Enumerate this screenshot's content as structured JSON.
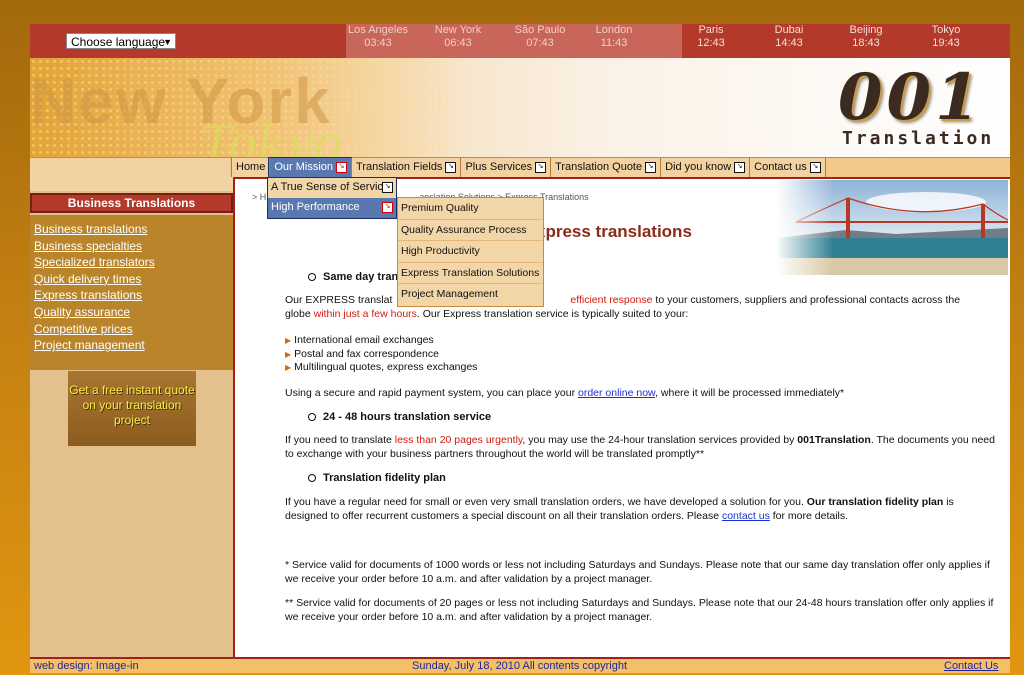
{
  "language_select": {
    "value": "Choose language"
  },
  "world_clocks": [
    {
      "city": "Los Angeles",
      "time": "03:43"
    },
    {
      "city": "New York",
      "time": "06:43"
    },
    {
      "city": "São Paulo",
      "time": "07:43"
    },
    {
      "city": "London",
      "time": "11:43"
    },
    {
      "city": "Paris",
      "time": "12:43"
    },
    {
      "city": "Dubai",
      "time": "14:43"
    },
    {
      "city": "Beijing",
      "time": "18:43"
    },
    {
      "city": "Tokyo",
      "time": "19:43"
    }
  ],
  "banner": {
    "city_word": "New York",
    "script_word": "Tokyo",
    "logo_number": "001",
    "logo_word": "Translation"
  },
  "nav": {
    "items": [
      "Home",
      "Our Mission",
      "Translation Fields",
      "Plus Services",
      "Translation Quote",
      "Did you know",
      "Contact us"
    ],
    "active": "Our Mission"
  },
  "mission_menu": [
    "A True Sense of Service",
    "High Performance"
  ],
  "performance_menu": [
    "Premium Quality",
    "Quality Assurance Process",
    "High Productivity",
    "Express Translation Solutions",
    "Project Management"
  ],
  "sidebar": {
    "heading": "Business Translations",
    "links": [
      "Business translations",
      "Business specialties",
      "Specialized translators",
      "Quick delivery times",
      "Express translations",
      "Quality assurance",
      "Competitive prices",
      "Project management"
    ],
    "quote_box": "Get a free instant quote on your translation project"
  },
  "main": {
    "breadcrumb": "> H",
    "breadcrumb_tail": "anslation Solutions > Express Translations",
    "title_visible": "xpress translations",
    "s1_heading": "Same day tran",
    "s1_p1_a": "Our EXPRESS translat",
    "s1_p1_b": "in response",
    "s1_p1_b_red_pre": "efficient response",
    "s1_p1_c": " to your customers, suppliers and professional contacts across the",
    "s1_p1_d": "globe ",
    "s1_p1_e_red": "within just a few hours",
    "s1_p1_f": ". Our Express translation service is typically suited to your:",
    "list": [
      "International email exchanges",
      "Postal and fax correspondence",
      "Multilingual quotes, express exchanges"
    ],
    "pay_a": "Using a secure and rapid payment system, you can place your ",
    "pay_link": "order online now",
    "pay_b": ", where it will be processed immediately*",
    "s2_heading": "24 - 48 hours translation service",
    "s2_a": "If you need to translate ",
    "s2_red": "less than 20 pages urgently",
    "s2_b": ", you may use the 24-hour translation services provided by ",
    "s2_bold": "001Translation",
    "s2_c": ". The documents you need to exchange with your business partners throughout the world will be translated promptly**",
    "s3_heading": "Translation fidelity plan",
    "s3_a": "If you have a regular need for small or even very small translation orders, we have developed a solution for you. ",
    "s3_bold": "Our translation fidelity plan",
    "s3_b": " is designed to offer recurrent customers a special discount on all their translation orders. Please ",
    "s3_link": "contact us",
    "s3_c": " for more details.",
    "note1": "* Service valid for documents of 1000 words or less not including Saturdays and Sundays. Please note that our same day translation offer only applies if we receive your order before 10 a.m. and after validation by a project manager.",
    "note2": "** Service valid for documents of 20 pages or less not including Saturdays and Sundays. Please note that our 24-48 hours translation offer only applies if we receive your order before 10 a.m. and after validation by a project manager."
  },
  "footer": {
    "left": "web design: Image-in",
    "center": "Sunday, July 18, 2010 All contents copyright",
    "right": "Contact Us"
  },
  "colors": {
    "topbar": "#b33a2a",
    "sidebar_links_bg": "#b9842a",
    "title": "#8a2b1a",
    "link": "#1a2fd0",
    "highlight": "#d11b0f"
  }
}
